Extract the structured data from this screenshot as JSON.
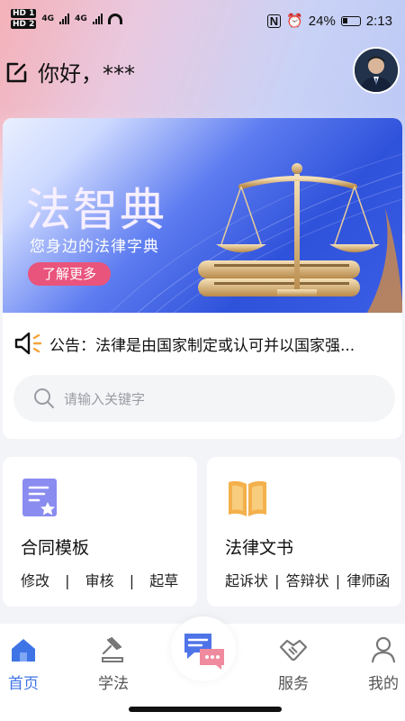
{
  "status_bar": {
    "sim1": "HD 1",
    "sim2": "HD 2",
    "net1": "4G",
    "net2": "4G",
    "battery": "24%",
    "time": "2:13"
  },
  "header": {
    "greeting": "你好，***"
  },
  "banner": {
    "title": "法智典",
    "subtitle": "您身边的法律字典",
    "button": "了解更多"
  },
  "notice": {
    "text": "公告：法律是由国家制定或认可并以国家强..."
  },
  "search": {
    "placeholder": "请输入关键字"
  },
  "tiles": [
    {
      "name": "合同模板",
      "subs": [
        "修改",
        "审核",
        "起草"
      ]
    },
    {
      "name": "法律文书",
      "subs": [
        "起诉状",
        "答辩状",
        "律师函"
      ]
    }
  ],
  "nav": {
    "items": [
      {
        "label": "首页",
        "active": true
      },
      {
        "label": "学法",
        "active": false
      },
      {
        "label": "服务",
        "active": false
      },
      {
        "label": "我的",
        "active": false
      }
    ]
  },
  "colors": {
    "accent": "#3f74e6",
    "banner_button": "#e9547c",
    "tile_icon_contract": "#8a8cf0",
    "tile_icon_book": "#f3b04b"
  }
}
